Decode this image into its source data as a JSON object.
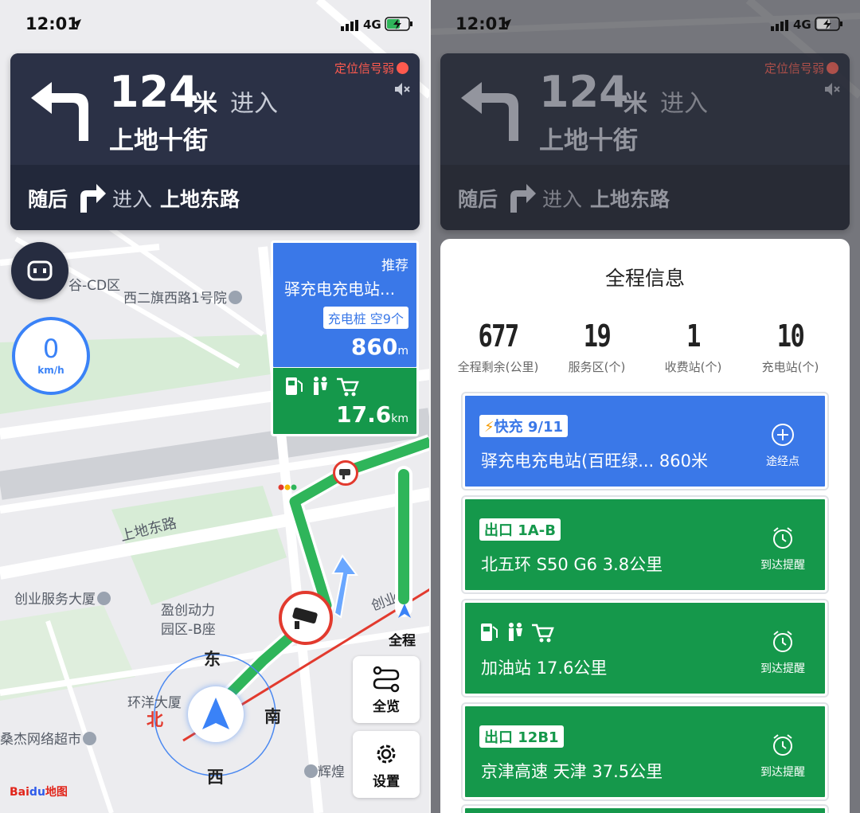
{
  "status": {
    "time": "12:01",
    "network": "4G"
  },
  "nav": {
    "distance": "124",
    "unit": "米",
    "enter": "进入",
    "road": "上地十街",
    "gps_weak": "定位信号弱",
    "next_label": "随后",
    "next_enter": "进入",
    "next_road": "上地东路"
  },
  "speed": {
    "value": "0",
    "unit": "km/h"
  },
  "map_labels": {
    "cd_area": "谷-CD区",
    "xierqi": "西二旗西路1号院",
    "shangdi_east": "上地东路",
    "chuangye": "创业服务大厦",
    "yingchuang_1": "盈创动力",
    "yingchuang_2": "园区-B座",
    "huanyang": "环洋大厦",
    "network_supermarket": "桑杰网络超市",
    "huihuang": "辉煌",
    "chuang_road": "创业路"
  },
  "compass": {
    "east": "东",
    "south": "南",
    "north": "北",
    "west": "西"
  },
  "charge_card": {
    "recommend": "推荐",
    "name": "驿充电充电站...",
    "badge": "充电桩 空9个",
    "distance": "860",
    "distance_unit": "m"
  },
  "service_card": {
    "distance": "17.6",
    "distance_unit": "km"
  },
  "buttons": {
    "full_route": "全程",
    "overview": "全览",
    "settings": "设置"
  },
  "logo": {
    "part1": "Bai",
    "part2": "du",
    "part3": "地图"
  },
  "panel": {
    "title": "全程信息",
    "stats": [
      {
        "value": "677",
        "label": "全程剩余(公里)"
      },
      {
        "value": "19",
        "label": "服务区(个)"
      },
      {
        "value": "1",
        "label": "收费站(个)"
      },
      {
        "value": "10",
        "label": "充电站(个)"
      }
    ],
    "cards": [
      {
        "badge": "快充 9/11",
        "line": "驿充电充电站(百旺绿...  860米",
        "action": "途经点"
      },
      {
        "badge": "出口 1A-B",
        "line": "北五环 S50 G6  3.8公里",
        "action": "到达提醒"
      },
      {
        "badge": "",
        "line": "加油站  17.6公里",
        "action": "到达提醒"
      },
      {
        "badge": "出口 12B1",
        "line": "京津高速 天津  37.5公里",
        "action": "到达提醒"
      }
    ]
  },
  "colors": {
    "nav_bg": "#2b3146",
    "blue": "#3a78e8",
    "green": "#15984b",
    "route": "#2fb55a",
    "alert": "#ff5a4e"
  }
}
